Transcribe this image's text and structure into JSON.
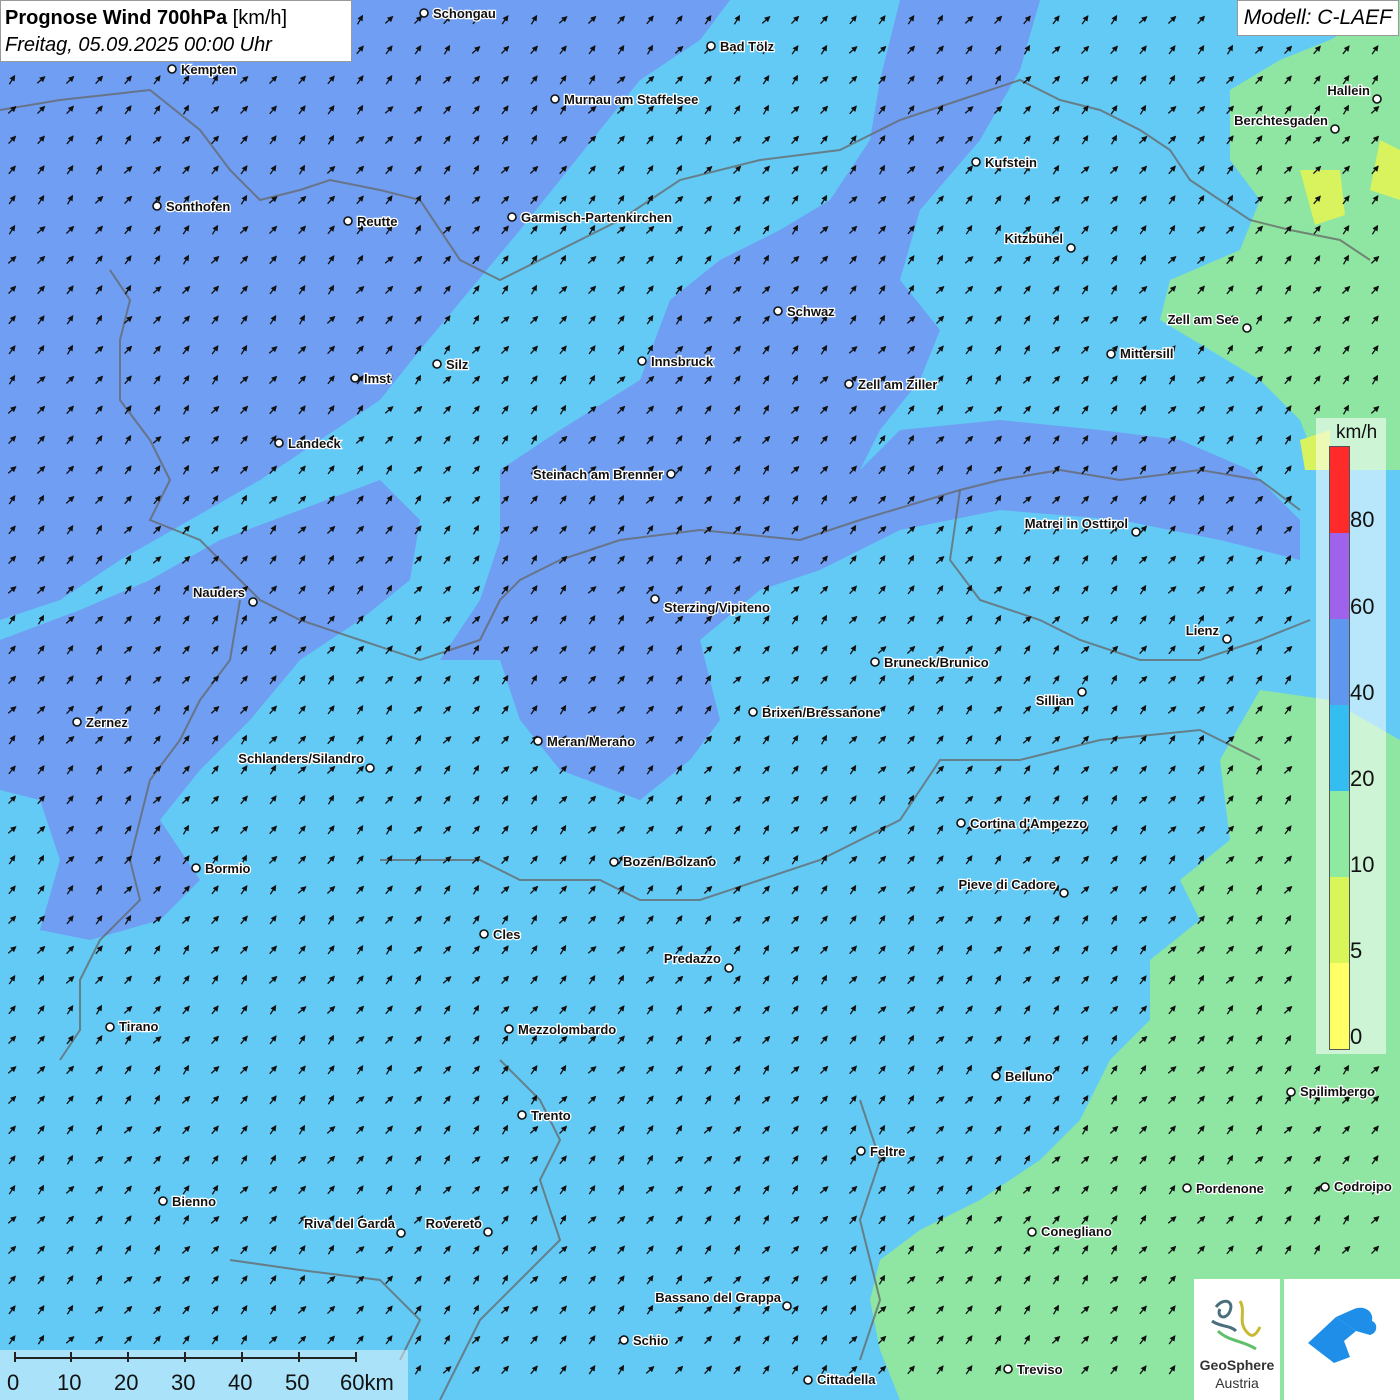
{
  "header": {
    "title": "Prognose Wind 700hPa",
    "unit": "[km/h]",
    "datetime": "Freitag, 05.09.2025 00:00 Uhr",
    "model": "Modell: C-LAEF"
  },
  "legend": {
    "unit": "km/h",
    "labels": [
      "80",
      "60",
      "40",
      "20",
      "10",
      "5",
      "0"
    ],
    "colors": [
      "#ff2a2a",
      "#9e63ea",
      "#5f97ef",
      "#33bdf0",
      "#8eeaa0",
      "#d8f55a",
      "#ffff66"
    ]
  },
  "scalebar": {
    "labels": [
      "0",
      "10",
      "20",
      "30",
      "40",
      "50",
      "60km"
    ]
  },
  "logos": {
    "geosphere_line1": "GeoSphere",
    "geosphere_line2": "Austria"
  },
  "places": [
    "Schongau",
    "Bad Tölz",
    "Kempten",
    "Murnau am Staffelsee",
    "Hallein",
    "Berchtesgaden",
    "Kufstein",
    "Sonthofen",
    "Reutte",
    "Garmisch-Partenkirchen",
    "Kitzbühel",
    "Schwaz",
    "Zell am See",
    "Innsbruck",
    "Mittersill",
    "Silz",
    "Imst",
    "Zell am Ziller",
    "Landeck",
    "Steinach am Brenner",
    "Matrei in Osttirol",
    "Nauders",
    "Sterzing/Vipiteno",
    "Lienz",
    "Bruneck/Brunico",
    "Sillian",
    "Brixen/Bressanone",
    "Zernez",
    "Meran/Merano",
    "Schlanders/Silandro",
    "Cortina d'Ampezzo",
    "Bozen/Bolzano",
    "Bormio",
    "Pieve di Cadore",
    "Cles",
    "Predazzo",
    "Tirano",
    "Mezzolombardo",
    "Belluno",
    "Spilimbergo",
    "Trento",
    "Feltre",
    "Pordenone",
    "Codroipo",
    "Bienno",
    "Riva del Garda",
    "Rovereto",
    "Conegliano",
    "Bassano del Grappa",
    "Schio",
    "Treviso",
    "Cittadella"
  ],
  "colors": {
    "wind_20_40": "#63caf5",
    "wind_40_60": "#6f9ef2",
    "wind_10_20": "#8ee6a2",
    "wind_5_10": "#d8f35e",
    "border": "#666666",
    "arrow": "#111111"
  }
}
